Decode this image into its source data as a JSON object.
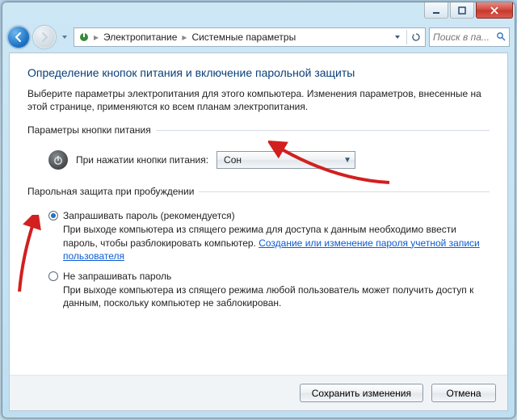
{
  "window": {
    "breadcrumb": {
      "root": "Электропитание",
      "leaf": "Системные параметры"
    },
    "search_placeholder": "Поиск в па..."
  },
  "page": {
    "title": "Определение кнопок питания и включение парольной защиты",
    "intro": "Выберите параметры электропитания для этого компьютера. Изменения параметров, внесенные на этой странице, применяются ко всем планам электропитания."
  },
  "power_button": {
    "legend": "Параметры кнопки питания",
    "label": "При нажатии кнопки питания:",
    "selected": "Сон"
  },
  "password": {
    "legend": "Парольная защита при пробуждении",
    "opt_require": {
      "label": "Запрашивать пароль (рекомендуется)",
      "desc_before": "При выходе компьютера из спящего режима для доступа к данным необходимо ввести пароль, чтобы разблокировать компьютер. ",
      "link": "Создание или изменение пароля учетной записи пользователя"
    },
    "opt_no": {
      "label": "Не запрашивать пароль",
      "desc": "При выходе компьютера из спящего режима любой пользователь может получить доступ к данным, поскольку компьютер не заблокирован."
    }
  },
  "footer": {
    "save": "Сохранить изменения",
    "cancel": "Отмена"
  }
}
